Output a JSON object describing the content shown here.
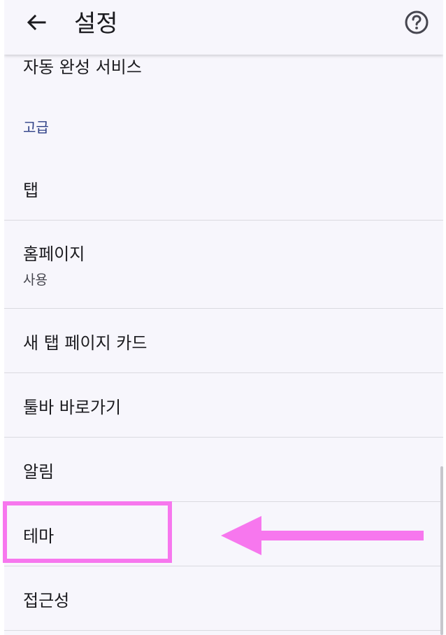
{
  "header": {
    "title": "설정",
    "back_icon": "arrow-left-icon",
    "help_icon": "help-circle-icon"
  },
  "rows": {
    "autofill": {
      "label": "자동 완성 서비스"
    },
    "advanced_header": {
      "label": "고급"
    },
    "tabs": {
      "label": "탭"
    },
    "homepage": {
      "label": "홈페이지",
      "sub": "사용"
    },
    "new_tab_cards": {
      "label": "새 탭 페이지 카드"
    },
    "toolbar_shortcut": {
      "label": "툴바 바로가기"
    },
    "notifications": {
      "label": "알림"
    },
    "theme": {
      "label": "테마"
    },
    "accessibility": {
      "label": "접근성"
    }
  },
  "annotation": {
    "highlight_color": "#f777ee",
    "target": "theme"
  },
  "colors": {
    "background": "#f7f6fc",
    "section_header": "#2d3f86",
    "text": "#1b1b1f"
  }
}
